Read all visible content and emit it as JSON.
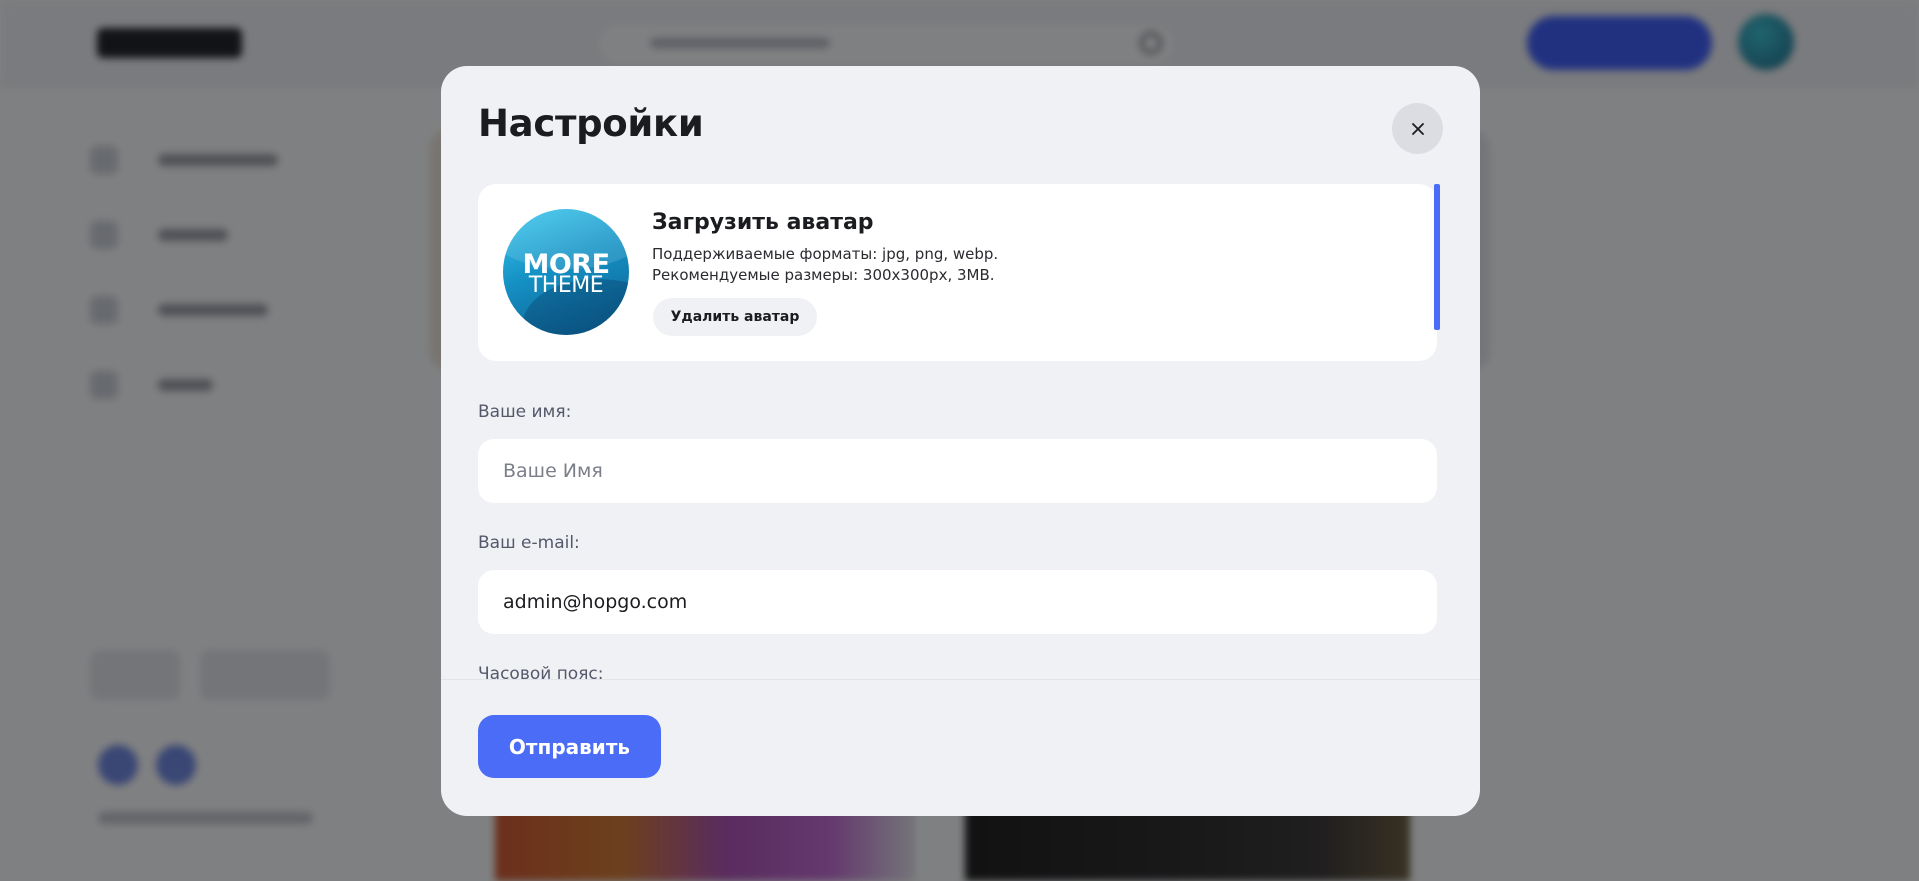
{
  "modal": {
    "title": "Настройки",
    "close_icon": "close-icon"
  },
  "avatar": {
    "image_text_top": "MORE",
    "image_text_bottom": "THEME",
    "upload_title": "Загрузить аватар",
    "formats_text": "Поддерживаемые форматы: jpg, png, webp.",
    "size_text": "Рекомендуемые размеры: 300x300px, 3MB.",
    "remove_label": "Удалить аватар"
  },
  "form": {
    "name_label": "Ваше имя:",
    "name_placeholder": "Ваше Имя",
    "name_value": "",
    "email_label": "Ваш e-mail:",
    "email_value": "admin@hopgo.com",
    "timezone_label": "Часовой пояс:"
  },
  "footer": {
    "submit_label": "Отправить"
  },
  "colors": {
    "accent": "#4a6cf7",
    "modal_bg": "#f0f1f5",
    "card_bg": "#ffffff",
    "text": "#1b1c20"
  }
}
